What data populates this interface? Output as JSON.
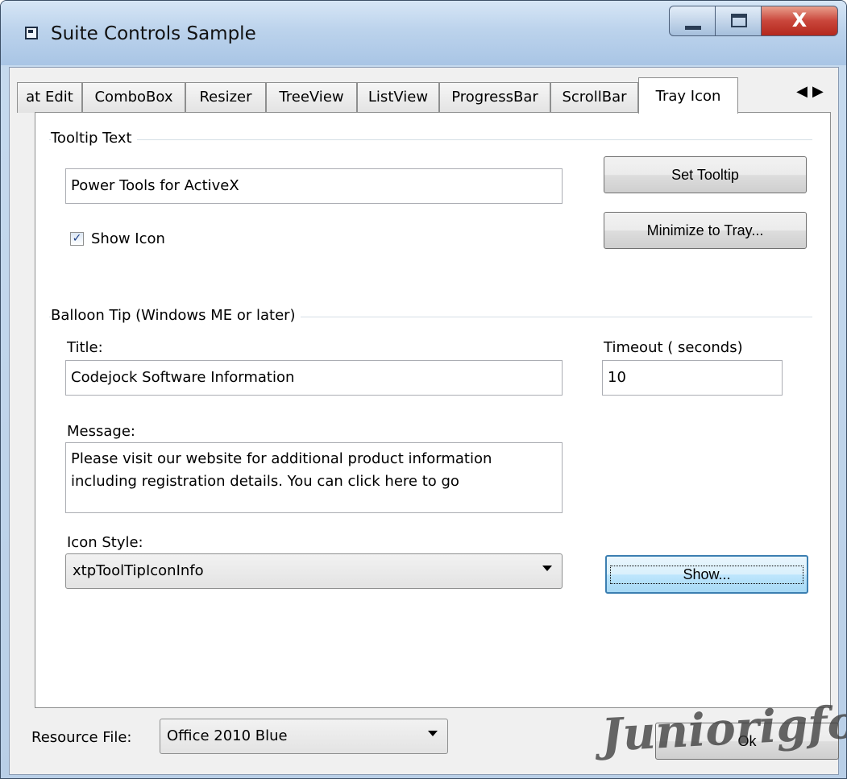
{
  "window": {
    "title": "Suite Controls Sample",
    "close_label": "X"
  },
  "tabs": [
    {
      "label": "at Edit"
    },
    {
      "label": "ComboBox"
    },
    {
      "label": "Resizer"
    },
    {
      "label": "TreeView"
    },
    {
      "label": "ListView"
    },
    {
      "label": "ProgressBar"
    },
    {
      "label": "ScrollBar"
    },
    {
      "label": "Tray Icon",
      "selected": true
    }
  ],
  "tab_scroll": {
    "left_glyph": "◀",
    "right_glyph": "▶"
  },
  "tooltip_group": {
    "label": "Tooltip Text",
    "tooltip_value": "Power Tools for ActiveX",
    "show_icon_label": "Show Icon",
    "show_icon_checked": true,
    "set_tooltip_label": "Set Tooltip",
    "minimize_label": "Minimize to Tray..."
  },
  "balloon_group": {
    "label": "Balloon Tip (Windows ME or later)",
    "title_label": "Title:",
    "title_value": "Codejock Software Information",
    "timeout_label": "Timeout ( seconds)",
    "timeout_value": "10",
    "message_label": "Message:",
    "message_line1": "Please visit our website for additional product information",
    "message_line2": "including registration details.  You can click here to go",
    "icon_style_label": "Icon Style:",
    "icon_style_value": "xtpToolTipIconInfo",
    "show_label": "Show..."
  },
  "footer": {
    "resource_file_label": "Resource File:",
    "resource_file_value": "Office 2010 Blue",
    "ok_label": "Ok"
  },
  "watermark": "Juniorigfor",
  "colors": {
    "title_bar": "#bcd3ec",
    "close_button": "#c9463b",
    "focus_border": "#3c7fb1"
  }
}
